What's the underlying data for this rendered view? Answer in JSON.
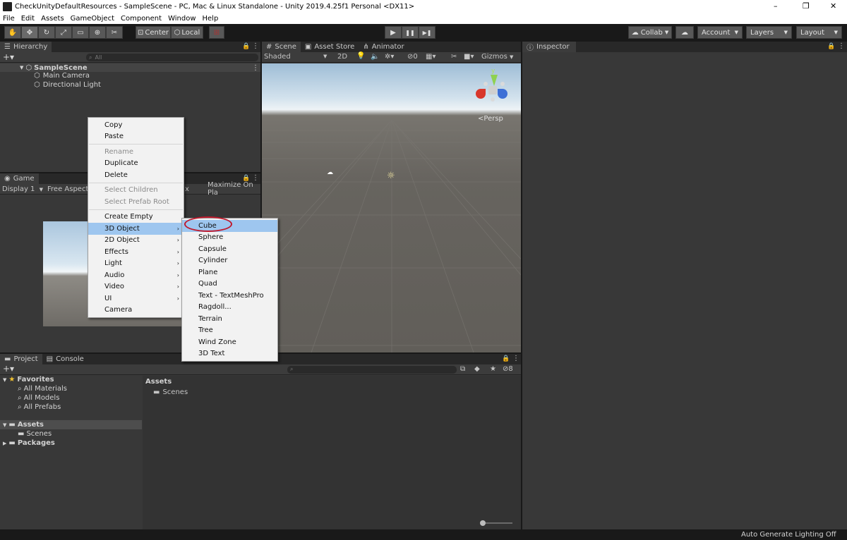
{
  "window": {
    "title": "CheckUnityDefaultResources - SampleScene - PC, Mac & Linux Standalone - Unity 2019.4.25f1 Personal <DX11>",
    "controls": {
      "minimize": "–",
      "restore": "❐",
      "close": "✕"
    }
  },
  "menubar": [
    "File",
    "Edit",
    "Assets",
    "GameObject",
    "Component",
    "Window",
    "Help"
  ],
  "toolbar": {
    "tools": [
      "hand-tool",
      "move-tool",
      "rotate-tool",
      "scale-tool",
      "rect-tool",
      "transform-tool",
      "custom-tool"
    ],
    "pivot": "Center",
    "space": "Local",
    "play_controls": [
      "▶",
      "❚❚",
      "▶❚"
    ],
    "collab": "Collab",
    "account": "Account",
    "layers": "Layers",
    "layout": "Layout"
  },
  "hierarchy": {
    "tab": "Hierarchy",
    "search_placeholder": "All",
    "scene": "SampleScene",
    "items": [
      "Main Camera",
      "Directional Light"
    ]
  },
  "game": {
    "tab": "Game",
    "display": "Display 1",
    "aspect": "Free Aspect",
    "scale_fragment": "x",
    "maximize": "Maximize On Pla"
  },
  "scene": {
    "tabs": [
      "Scene",
      "Asset Store",
      "Animator"
    ],
    "shading": "Shaded",
    "mode_2d": "2D",
    "hidden_count": "0",
    "gizmos": "Gizmos",
    "persp": "Persp",
    "axis_y": "y",
    "colors": {
      "sky_top": "#9dbdd6",
      "horizon": "#eaf2f7",
      "ground": "#666460"
    }
  },
  "inspector": {
    "tab": "Inspector"
  },
  "project": {
    "tabs": [
      "Project",
      "Console"
    ],
    "favorites": "Favorites",
    "favorite_items": [
      "All Materials",
      "All Models",
      "All Prefabs"
    ],
    "assets": "Assets",
    "assets_children": [
      "Scenes"
    ],
    "packages": "Packages",
    "content_header": "Assets",
    "content_items": [
      "Scenes"
    ],
    "hidden_count": "8"
  },
  "context_menu": {
    "items": [
      {
        "label": "Copy",
        "enabled": true
      },
      {
        "label": "Paste",
        "enabled": true
      },
      {
        "separator": true
      },
      {
        "label": "Rename",
        "enabled": false
      },
      {
        "label": "Duplicate",
        "enabled": true
      },
      {
        "label": "Delete",
        "enabled": true
      },
      {
        "separator": true
      },
      {
        "label": "Select Children",
        "enabled": false
      },
      {
        "label": "Select Prefab Root",
        "enabled": false
      },
      {
        "separator": true
      },
      {
        "label": "Create Empty",
        "enabled": true
      },
      {
        "label": "3D Object",
        "enabled": true,
        "submenu": true,
        "highlighted": true
      },
      {
        "label": "2D Object",
        "enabled": true,
        "submenu": true
      },
      {
        "label": "Effects",
        "enabled": true,
        "submenu": true
      },
      {
        "label": "Light",
        "enabled": true,
        "submenu": true
      },
      {
        "label": "Audio",
        "enabled": true,
        "submenu": true
      },
      {
        "label": "Video",
        "enabled": true,
        "submenu": true
      },
      {
        "label": "UI",
        "enabled": true,
        "submenu": true
      },
      {
        "label": "Camera",
        "enabled": true
      }
    ]
  },
  "submenu_3d": {
    "items": [
      "Cube",
      "Sphere",
      "Capsule",
      "Cylinder",
      "Plane",
      "Quad",
      "Text - TextMeshPro",
      "Ragdoll...",
      "Terrain",
      "Tree",
      "Wind Zone",
      "3D Text"
    ],
    "highlighted": "Cube",
    "annotation_color": "#c0192c"
  },
  "status": "Auto Generate Lighting Off"
}
